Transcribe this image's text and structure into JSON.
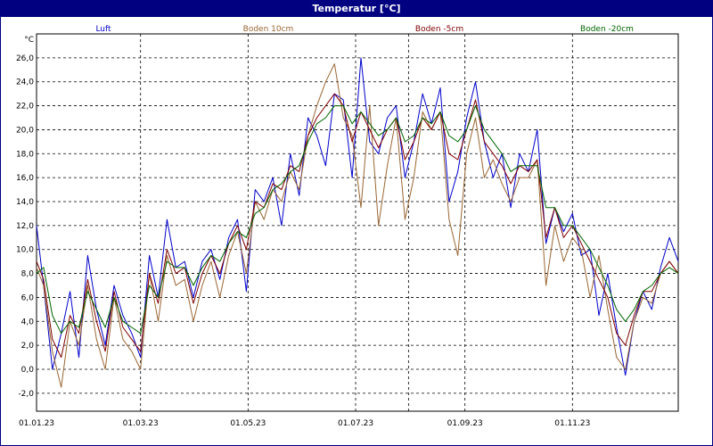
{
  "window": {
    "title": "Temperatur [°C]"
  },
  "chart_data": {
    "type": "line",
    "title": "Temperatur [°C]",
    "ylabel": "°C",
    "ylim": [
      -3.5,
      28.0
    ],
    "xlim": [
      "2023-01-01",
      "2023-12-31"
    ],
    "grid": true,
    "legend_position": "top",
    "y_ticks": [
      "-2,0",
      "0,0",
      "2,0",
      "4,0",
      "6,0",
      "8,0",
      "10,0",
      "12,0",
      "14,0",
      "16,0",
      "18,0",
      "20,0",
      "22,0",
      "24,0",
      "26,0"
    ],
    "y_tick_values": [
      -2,
      0,
      2,
      4,
      6,
      8,
      10,
      12,
      14,
      16,
      18,
      20,
      22,
      24,
      26
    ],
    "x_ticks": [
      "01.01.23",
      "01.03.23",
      "01.05.23",
      "01.07.23",
      "01.09.23",
      "01.11.23"
    ],
    "x_tick_dates": [
      "2023-01-01",
      "2023-03-01",
      "2023-05-01",
      "2023-07-01",
      "2023-09-01",
      "2023-11-01"
    ],
    "x_grid_extra_dates": [
      "2023-07-31"
    ],
    "series": [
      {
        "name": "Luft",
        "color": "#0000cc",
        "x": [
          "2023-01-01",
          "2023-01-05",
          "2023-01-10",
          "2023-01-15",
          "2023-01-20",
          "2023-01-25",
          "2023-01-30",
          "2023-02-04",
          "2023-02-09",
          "2023-02-14",
          "2023-02-19",
          "2023-02-24",
          "2023-03-01",
          "2023-03-06",
          "2023-03-11",
          "2023-03-16",
          "2023-03-21",
          "2023-03-26",
          "2023-03-31",
          "2023-04-05",
          "2023-04-10",
          "2023-04-15",
          "2023-04-20",
          "2023-04-25",
          "2023-04-30",
          "2023-05-05",
          "2023-05-10",
          "2023-05-15",
          "2023-05-20",
          "2023-05-25",
          "2023-05-30",
          "2023-06-04",
          "2023-06-09",
          "2023-06-14",
          "2023-06-19",
          "2023-06-24",
          "2023-06-29",
          "2023-07-04",
          "2023-07-09",
          "2023-07-14",
          "2023-07-19",
          "2023-07-24",
          "2023-07-29",
          "2023-08-03",
          "2023-08-08",
          "2023-08-13",
          "2023-08-18",
          "2023-08-23",
          "2023-08-28",
          "2023-09-02",
          "2023-09-07",
          "2023-09-12",
          "2023-09-17",
          "2023-09-22",
          "2023-09-27",
          "2023-10-02",
          "2023-10-07",
          "2023-10-12",
          "2023-10-17",
          "2023-10-22",
          "2023-10-27",
          "2023-11-01",
          "2023-11-06",
          "2023-11-11",
          "2023-11-16",
          "2023-11-21",
          "2023-11-26",
          "2023-12-01",
          "2023-12-06",
          "2023-12-11",
          "2023-12-16",
          "2023-12-21",
          "2023-12-26",
          "2023-12-31"
        ],
        "y": [
          12.0,
          7.0,
          0.0,
          3.0,
          6.5,
          1.0,
          9.5,
          5.0,
          2.0,
          7.0,
          4.5,
          3.0,
          1.0,
          9.5,
          6.0,
          12.5,
          8.5,
          9.0,
          6.0,
          9.0,
          10.0,
          7.5,
          11.0,
          12.5,
          6.5,
          15.0,
          14.0,
          16.0,
          12.0,
          18.0,
          14.5,
          21.0,
          19.5,
          17.0,
          23.0,
          22.5,
          16.0,
          26.0,
          19.0,
          18.0,
          21.0,
          22.0,
          16.0,
          19.0,
          23.0,
          20.5,
          23.5,
          14.0,
          16.5,
          21.0,
          24.0,
          19.0,
          16.0,
          18.0,
          13.5,
          18.0,
          16.5,
          20.0,
          10.5,
          13.5,
          11.5,
          13.0,
          9.5,
          10.0,
          4.5,
          8.0,
          3.5,
          -0.5,
          4.0,
          6.5,
          5.0,
          8.5,
          11.0,
          9.0
        ]
      },
      {
        "name": "Boden 10cm",
        "color": "#996633",
        "x": [
          "2023-01-01",
          "2023-01-05",
          "2023-01-10",
          "2023-01-15",
          "2023-01-20",
          "2023-01-25",
          "2023-01-30",
          "2023-02-04",
          "2023-02-09",
          "2023-02-14",
          "2023-02-19",
          "2023-02-24",
          "2023-03-01",
          "2023-03-06",
          "2023-03-11",
          "2023-03-16",
          "2023-03-21",
          "2023-03-26",
          "2023-03-31",
          "2023-04-05",
          "2023-04-10",
          "2023-04-15",
          "2023-04-20",
          "2023-04-25",
          "2023-04-30",
          "2023-05-05",
          "2023-05-10",
          "2023-05-15",
          "2023-05-20",
          "2023-05-25",
          "2023-05-30",
          "2023-06-04",
          "2023-06-09",
          "2023-06-14",
          "2023-06-19",
          "2023-06-24",
          "2023-06-29",
          "2023-07-04",
          "2023-07-09",
          "2023-07-14",
          "2023-07-19",
          "2023-07-24",
          "2023-07-29",
          "2023-08-03",
          "2023-08-08",
          "2023-08-13",
          "2023-08-18",
          "2023-08-23",
          "2023-08-28",
          "2023-09-02",
          "2023-09-07",
          "2023-09-12",
          "2023-09-17",
          "2023-09-22",
          "2023-09-27",
          "2023-10-02",
          "2023-10-07",
          "2023-10-12",
          "2023-10-17",
          "2023-10-22",
          "2023-10-27",
          "2023-11-01",
          "2023-11-06",
          "2023-11-11",
          "2023-11-16",
          "2023-11-21",
          "2023-11-26",
          "2023-12-01",
          "2023-12-06",
          "2023-12-11",
          "2023-12-16",
          "2023-12-21",
          "2023-12-26",
          "2023-12-31"
        ],
        "y": [
          8.5,
          7.0,
          1.5,
          -1.5,
          4.0,
          2.0,
          7.0,
          2.5,
          0.0,
          6.0,
          2.5,
          1.5,
          0.0,
          8.0,
          4.0,
          9.5,
          7.0,
          7.5,
          4.0,
          7.0,
          9.0,
          6.0,
          9.5,
          11.5,
          8.0,
          14.0,
          12.5,
          15.0,
          14.0,
          16.5,
          15.0,
          19.5,
          22.0,
          24.0,
          25.5,
          21.0,
          19.5,
          13.5,
          22.0,
          12.0,
          17.0,
          21.0,
          12.5,
          16.0,
          21.5,
          20.0,
          21.5,
          12.5,
          9.5,
          18.0,
          21.0,
          16.0,
          17.5,
          15.5,
          14.0,
          16.0,
          16.0,
          17.5,
          7.0,
          12.0,
          9.0,
          11.0,
          10.0,
          6.0,
          9.5,
          5.0,
          1.0,
          0.0,
          4.0,
          6.0,
          5.5,
          8.0,
          9.0,
          8.0
        ]
      },
      {
        "name": "Boden -5cm",
        "color": "#800000",
        "x": [
          "2023-01-01",
          "2023-01-05",
          "2023-01-10",
          "2023-01-15",
          "2023-01-20",
          "2023-01-25",
          "2023-01-30",
          "2023-02-04",
          "2023-02-09",
          "2023-02-14",
          "2023-02-19",
          "2023-02-24",
          "2023-03-01",
          "2023-03-06",
          "2023-03-11",
          "2023-03-16",
          "2023-03-21",
          "2023-03-26",
          "2023-03-31",
          "2023-04-05",
          "2023-04-10",
          "2023-04-15",
          "2023-04-20",
          "2023-04-25",
          "2023-04-30",
          "2023-05-05",
          "2023-05-10",
          "2023-05-15",
          "2023-05-20",
          "2023-05-25",
          "2023-05-30",
          "2023-06-04",
          "2023-06-09",
          "2023-06-14",
          "2023-06-19",
          "2023-06-24",
          "2023-06-29",
          "2023-07-04",
          "2023-07-09",
          "2023-07-14",
          "2023-07-19",
          "2023-07-24",
          "2023-07-29",
          "2023-08-03",
          "2023-08-08",
          "2023-08-13",
          "2023-08-18",
          "2023-08-23",
          "2023-08-28",
          "2023-09-02",
          "2023-09-07",
          "2023-09-12",
          "2023-09-17",
          "2023-09-22",
          "2023-09-27",
          "2023-10-02",
          "2023-10-07",
          "2023-10-12",
          "2023-10-17",
          "2023-10-22",
          "2023-10-27",
          "2023-11-01",
          "2023-11-06",
          "2023-11-11",
          "2023-11-16",
          "2023-11-21",
          "2023-11-26",
          "2023-12-01",
          "2023-12-06",
          "2023-12-11",
          "2023-12-16",
          "2023-12-21",
          "2023-12-26",
          "2023-12-31"
        ],
        "y": [
          9.0,
          7.5,
          2.5,
          1.0,
          4.5,
          3.0,
          7.5,
          4.0,
          1.5,
          6.5,
          3.5,
          2.5,
          1.5,
          8.0,
          5.5,
          10.0,
          8.0,
          8.5,
          5.5,
          8.0,
          9.5,
          8.0,
          10.5,
          12.0,
          10.0,
          14.0,
          13.5,
          15.5,
          15.0,
          17.0,
          16.5,
          19.5,
          21.0,
          22.0,
          23.0,
          22.0,
          19.0,
          21.5,
          20.0,
          18.5,
          20.0,
          21.0,
          17.5,
          19.0,
          21.0,
          20.0,
          21.5,
          18.0,
          17.5,
          20.0,
          22.5,
          19.0,
          18.0,
          17.0,
          15.5,
          17.0,
          16.5,
          17.5,
          11.0,
          13.5,
          11.0,
          12.0,
          10.5,
          9.0,
          7.5,
          6.0,
          3.0,
          2.0,
          4.5,
          6.5,
          6.5,
          8.0,
          9.0,
          8.0
        ]
      },
      {
        "name": "Boden -20cm",
        "color": "#006600",
        "x": [
          "2023-01-01",
          "2023-01-05",
          "2023-01-10",
          "2023-01-15",
          "2023-01-20",
          "2023-01-25",
          "2023-01-30",
          "2023-02-04",
          "2023-02-09",
          "2023-02-14",
          "2023-02-19",
          "2023-02-24",
          "2023-03-01",
          "2023-03-06",
          "2023-03-11",
          "2023-03-16",
          "2023-03-21",
          "2023-03-26",
          "2023-03-31",
          "2023-04-05",
          "2023-04-10",
          "2023-04-15",
          "2023-04-20",
          "2023-04-25",
          "2023-04-30",
          "2023-05-05",
          "2023-05-10",
          "2023-05-15",
          "2023-05-20",
          "2023-05-25",
          "2023-05-30",
          "2023-06-04",
          "2023-06-09",
          "2023-06-14",
          "2023-06-19",
          "2023-06-24",
          "2023-06-29",
          "2023-07-04",
          "2023-07-09",
          "2023-07-14",
          "2023-07-19",
          "2023-07-24",
          "2023-07-29",
          "2023-08-03",
          "2023-08-08",
          "2023-08-13",
          "2023-08-18",
          "2023-08-23",
          "2023-08-28",
          "2023-09-02",
          "2023-09-07",
          "2023-09-12",
          "2023-09-17",
          "2023-09-22",
          "2023-09-27",
          "2023-10-02",
          "2023-10-07",
          "2023-10-12",
          "2023-10-17",
          "2023-10-22",
          "2023-10-27",
          "2023-11-01",
          "2023-11-06",
          "2023-11-11",
          "2023-11-16",
          "2023-11-21",
          "2023-11-26",
          "2023-12-01",
          "2023-12-06",
          "2023-12-11",
          "2023-12-16",
          "2023-12-21",
          "2023-12-26",
          "2023-12-31"
        ],
        "y": [
          8.0,
          8.5,
          4.5,
          3.0,
          4.0,
          3.5,
          6.5,
          5.0,
          3.5,
          6.0,
          4.0,
          3.5,
          3.0,
          7.0,
          6.0,
          9.0,
          8.5,
          8.5,
          7.0,
          8.5,
          9.5,
          9.0,
          10.5,
          11.5,
          11.0,
          13.0,
          13.5,
          15.0,
          15.5,
          16.5,
          17.0,
          19.0,
          20.5,
          21.0,
          22.0,
          22.0,
          20.5,
          21.5,
          20.5,
          19.5,
          20.0,
          21.0,
          19.0,
          19.5,
          21.0,
          20.5,
          21.5,
          19.5,
          19.0,
          20.0,
          22.0,
          20.0,
          19.0,
          18.0,
          16.5,
          17.0,
          17.0,
          17.0,
          13.5,
          13.5,
          12.0,
          12.0,
          11.0,
          10.0,
          8.5,
          7.0,
          5.0,
          4.0,
          5.0,
          6.5,
          7.0,
          8.0,
          8.5,
          8.0
        ]
      }
    ]
  }
}
